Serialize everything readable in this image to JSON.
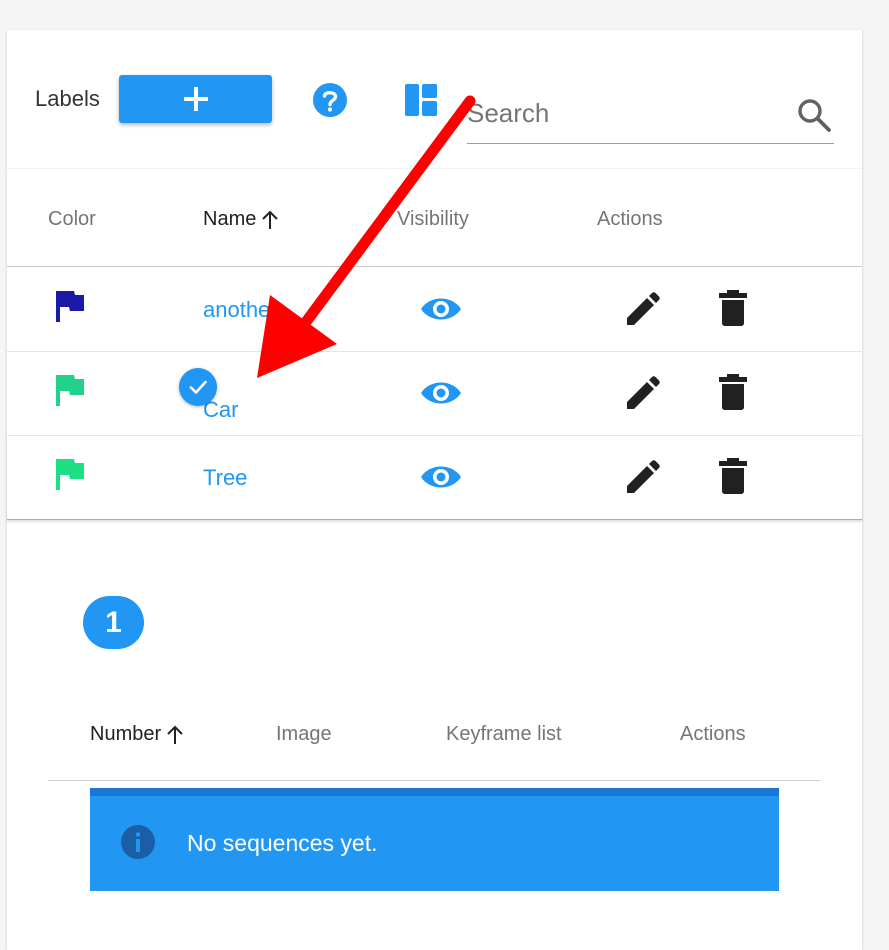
{
  "labels_panel": {
    "title": "Labels",
    "add_button_icon": "plus-icon",
    "help_icon": "help-circle-icon",
    "layout_icon": "view-dashboard-icon",
    "search": {
      "placeholder": "Search",
      "value": ""
    }
  },
  "labels_table": {
    "headers": {
      "color": "Color",
      "name": "Name",
      "visibility": "Visibility",
      "actions": "Actions"
    },
    "sort": {
      "column": "name",
      "direction": "ascending",
      "icon": "arrow-up-icon"
    },
    "rows": [
      {
        "name": "another",
        "flag_color": "#1a1aa6",
        "visible": true,
        "selected": false
      },
      {
        "name": "Car",
        "flag_color": "#21d38a",
        "visible": true,
        "selected": true
      },
      {
        "name": "Tree",
        "flag_color": "#1de084",
        "visible": true,
        "selected": false
      }
    ],
    "row_action_icons": [
      "pencil-icon",
      "trash-icon"
    ]
  },
  "pagination": {
    "current_page": "1"
  },
  "sequences_table": {
    "headers": {
      "number": "Number",
      "image": "Image",
      "keyframe_list": "Keyframe list",
      "actions": "Actions"
    },
    "sort": {
      "column": "number",
      "direction": "ascending"
    },
    "empty_message": "No sequences yet.",
    "empty_icon": "info-icon"
  },
  "annotation": {
    "type": "red-arrow",
    "points_to": "Car"
  },
  "colors": {
    "accent": "#2196f3",
    "alert_dark": "#1976d2",
    "arrow": "#ff0000"
  }
}
